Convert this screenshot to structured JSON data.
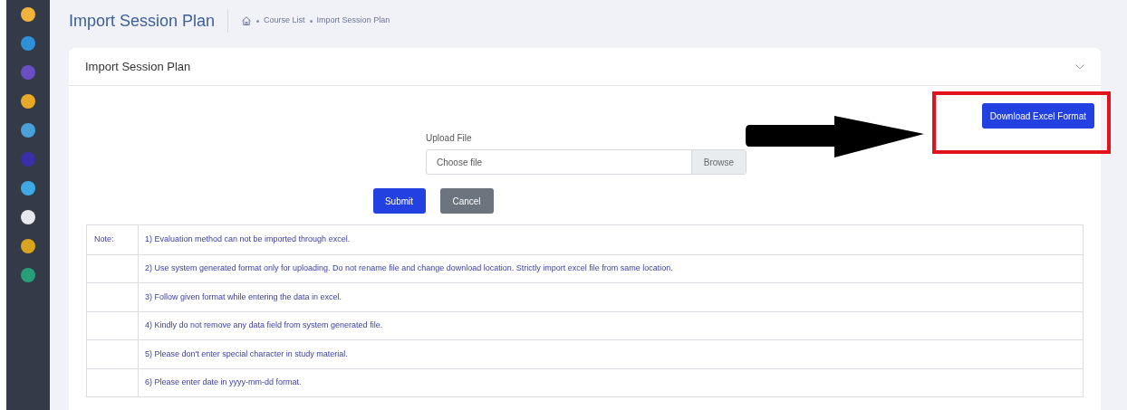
{
  "page": {
    "title": "Import Session Plan",
    "breadcrumb": [
      "Course List",
      "Import Session Plan"
    ]
  },
  "sidebar": {
    "icons": [
      {
        "color": "#f2b33d"
      },
      {
        "color": "#2f8fd8"
      },
      {
        "color": "#6a4fc4"
      },
      {
        "color": "#e8a928"
      },
      {
        "color": "#4aa0d8"
      },
      {
        "color": "#3a2fa8"
      },
      {
        "color": "#3fa9e8"
      },
      {
        "color": "#e8e8f0"
      },
      {
        "color": "#d9a520"
      },
      {
        "color": "#27a07a"
      }
    ]
  },
  "card": {
    "title": "Import Session Plan",
    "download_button": "Download Excel Format",
    "upload": {
      "label": "Upload File",
      "placeholder": "Choose file",
      "browse": "Browse"
    },
    "submit": "Submit",
    "cancel": "Cancel",
    "notes": {
      "heading": "Note:",
      "items": [
        "1) Evaluation method can not be imported through excel.",
        "2) Use system generated format only for uploading. Do not rename file and change download location. Strictly import excel file from same location.",
        "3) Follow given format while entering the data in excel.",
        "4) Kindly do not remove any data field from system generated file.",
        "5) Please don't enter special character in study material.",
        "6) Please enter date in yyyy-mm-dd format."
      ]
    }
  }
}
